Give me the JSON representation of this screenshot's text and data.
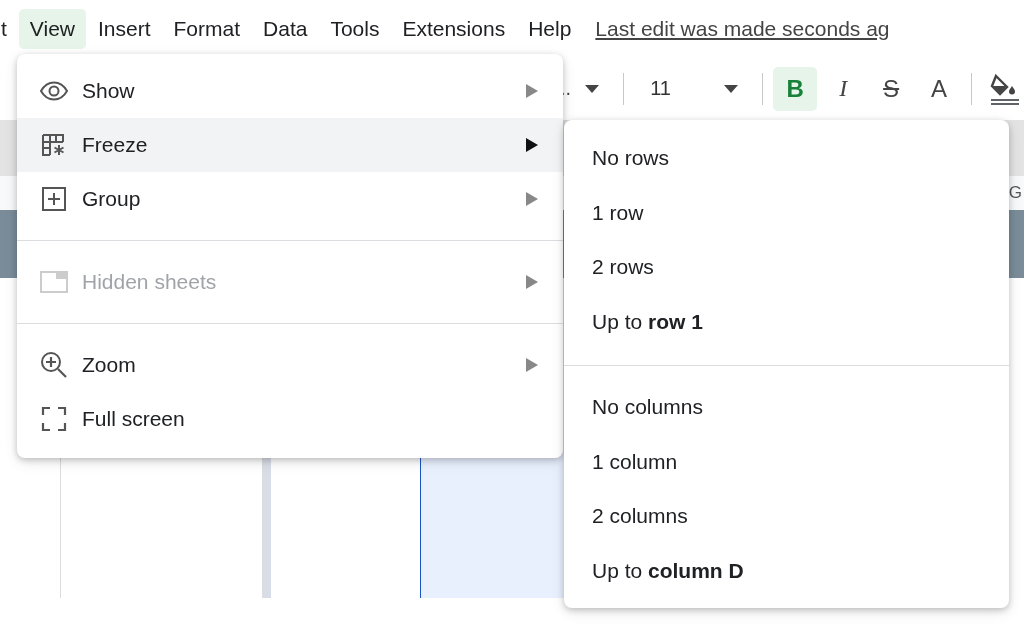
{
  "menubar": {
    "items": [
      {
        "label": "t",
        "selected": false
      },
      {
        "label": "View",
        "selected": true
      },
      {
        "label": "Insert",
        "selected": false
      },
      {
        "label": "Format",
        "selected": false
      },
      {
        "label": "Data",
        "selected": false
      },
      {
        "label": "Tools",
        "selected": false
      },
      {
        "label": "Extensions",
        "selected": false
      },
      {
        "label": "Help",
        "selected": false
      }
    ],
    "last_edit": "Last edit was made seconds ag"
  },
  "toolbar": {
    "font_name": "..",
    "font_size": "11",
    "format_buttons": [
      {
        "kind": "bold",
        "label": "B",
        "selected": true
      },
      {
        "kind": "italic",
        "label": "I",
        "selected": false
      },
      {
        "kind": "strike",
        "label": "S",
        "selected": false
      },
      {
        "kind": "color",
        "label": "A",
        "selected": false
      }
    ]
  },
  "grid": {
    "column_header": "G"
  },
  "view_menu": {
    "items": [
      {
        "kind": "item",
        "label": "Show",
        "submenu": true,
        "selected": false,
        "disabled": false
      },
      {
        "kind": "item",
        "label": "Freeze",
        "submenu": true,
        "selected": true,
        "disabled": false
      },
      {
        "kind": "item",
        "label": "Group",
        "submenu": true,
        "selected": false,
        "disabled": false
      },
      {
        "kind": "divider"
      },
      {
        "kind": "item",
        "label": "Hidden sheets",
        "submenu": true,
        "selected": false,
        "disabled": true
      },
      {
        "kind": "divider"
      },
      {
        "kind": "item",
        "label": "Zoom",
        "submenu": true,
        "selected": false,
        "disabled": false
      },
      {
        "kind": "item",
        "label": "Full screen",
        "submenu": false,
        "selected": false,
        "disabled": false
      }
    ]
  },
  "freeze_submenu": {
    "items": [
      {
        "kind": "item",
        "label": "No rows"
      },
      {
        "kind": "item",
        "label": "1 row"
      },
      {
        "kind": "item",
        "label": "2 rows"
      },
      {
        "kind": "item",
        "label": "Up to **row 1**"
      },
      {
        "kind": "divider"
      },
      {
        "kind": "item",
        "label": "No columns"
      },
      {
        "kind": "item",
        "label": "1 column"
      },
      {
        "kind": "item",
        "label": "2 columns"
      },
      {
        "kind": "item",
        "label": "Up to **column D**"
      }
    ]
  }
}
